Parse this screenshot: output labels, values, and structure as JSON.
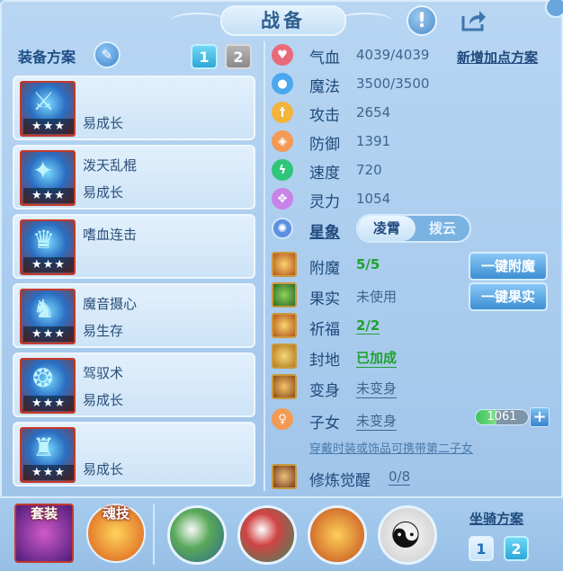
{
  "title": "战备",
  "colors": {
    "accent": "#2ea7d6",
    "green": "#1fa22d",
    "text": "#1f4a7c",
    "panel": "#a9cbed"
  },
  "header": {
    "alert_icon": "!",
    "share_icon": "share-icon"
  },
  "left": {
    "header": "装备方案",
    "tabs": [
      "1",
      "2"
    ],
    "active_tab": "1",
    "skills": [
      {
        "name": "",
        "tag": "易成长",
        "stars": "★★★"
      },
      {
        "name": "泼天乱棍",
        "tag": "易成长",
        "stars": "★★★"
      },
      {
        "name": "嗜血连击",
        "tag": "",
        "stars": "★★★"
      },
      {
        "name": "魔音摄心",
        "tag": "易生存",
        "stars": "★★★"
      },
      {
        "name": "驾驭术",
        "tag": "易成长",
        "stars": "★★★"
      },
      {
        "name": "",
        "tag": "易成长",
        "stars": "★★★"
      }
    ]
  },
  "stats": {
    "add_plan": "新增加点方案",
    "items": [
      {
        "label": "气血",
        "value": "4039/4039",
        "icon": "heart-icon"
      },
      {
        "label": "魔法",
        "value": "3500/3500",
        "icon": "mana-icon"
      },
      {
        "label": "攻击",
        "value": "2654",
        "icon": "sword-icon"
      },
      {
        "label": "防御",
        "value": "1391",
        "icon": "shield-icon"
      },
      {
        "label": "速度",
        "value": "720",
        "icon": "speed-icon"
      },
      {
        "label": "灵力",
        "value": "1054",
        "icon": "spirit-icon"
      }
    ]
  },
  "star": {
    "label": "星象",
    "options": [
      "凌霄",
      "拨云"
    ]
  },
  "rows": [
    {
      "label": "附魔",
      "value": "5/5",
      "style": "green-plain"
    },
    {
      "label": "果实",
      "value": "未使用",
      "style": "plain"
    },
    {
      "label": "祈福",
      "value": "2/2",
      "style": "green"
    },
    {
      "label": "封地",
      "value": "已加成",
      "style": "green"
    },
    {
      "label": "变身",
      "value": "未变身",
      "style": "link"
    }
  ],
  "buttons": {
    "enchant": "一键附魔",
    "fruit": "一键果实"
  },
  "child": {
    "label": "子女",
    "value": "未变身",
    "exp": "1061",
    "exp_fill": 0.4,
    "plus": "+",
    "hint": "穿戴时装或饰品可携带第二子女"
  },
  "awaken": {
    "label": "修炼觉醒",
    "value": "0/8"
  },
  "bottom": {
    "set_label": "套装",
    "soul_label": "魂技",
    "mount_label": "坐骑方案",
    "mount_tabs": [
      "1",
      "2"
    ],
    "active_mount": "2"
  }
}
